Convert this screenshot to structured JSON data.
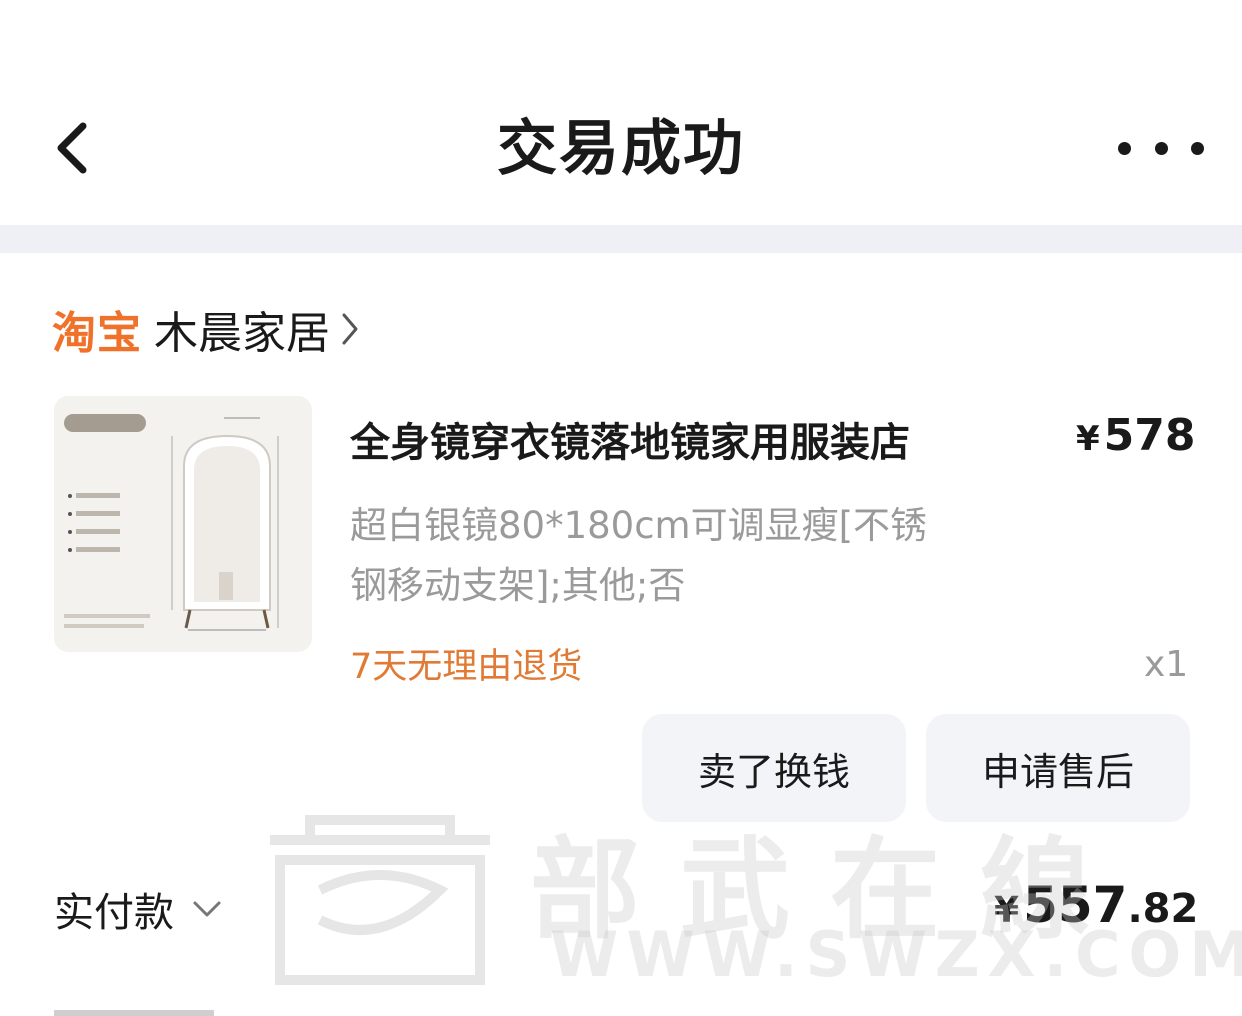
{
  "header": {
    "title": "交易成功"
  },
  "shop": {
    "platform": "淘宝",
    "name": "木晨家居"
  },
  "product": {
    "title": "全身镜穿衣镜落地镜家用服装店",
    "price_symbol": "¥",
    "price": "578",
    "spec_line1": "超白银镜80*180cm可调显瘦[不锈",
    "spec_line2": "钢移动支架];其他;否",
    "return_policy": "7天无理由退货",
    "quantity": "x1"
  },
  "actions": {
    "resell_label": "卖了换钱",
    "aftersale_label": "申请售后"
  },
  "payment": {
    "label": "实付款",
    "symbol": "¥",
    "amount_int": "557",
    "amount_dec": ".82"
  },
  "watermark": {
    "text_cn": "部武在線",
    "url": "WWW.SWZX.COM"
  },
  "colors": {
    "accent_orange": "#f0712a",
    "return_orange": "#e07a34",
    "band": "#eef0f6",
    "button_bg": "#f2f4f8"
  }
}
